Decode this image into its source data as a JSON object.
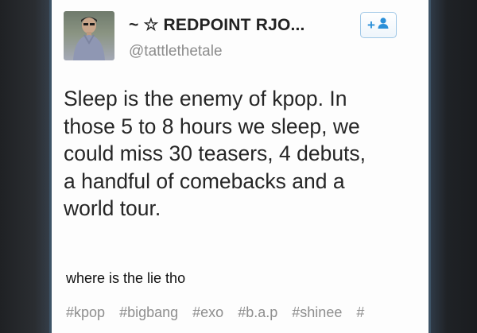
{
  "tweet": {
    "display_name": "~ ☆ REDPOINT RJO...",
    "handle": "@tattlethetale",
    "follow_button": {
      "label": "+",
      "icon": "person-icon"
    },
    "text_lines": [
      "Sleep is the enemy of kpop. In",
      "those 5 to 8 hours we sleep, we",
      "could miss 30 teasers, 4 debuts,",
      "a handful of comebacks and a",
      "world tour."
    ]
  },
  "post": {
    "caption": "where is the lie tho",
    "tags": [
      "#kpop",
      "#bigbang",
      "#exo",
      "#b.a.p",
      "#shinee",
      "#"
    ]
  },
  "colors": {
    "background": "#1b1d20",
    "card": "#fdfdfd",
    "follow_accent": "#2a8fd8",
    "handle_text": "#8c8c8c",
    "tag_text": "#8e8e8e"
  }
}
